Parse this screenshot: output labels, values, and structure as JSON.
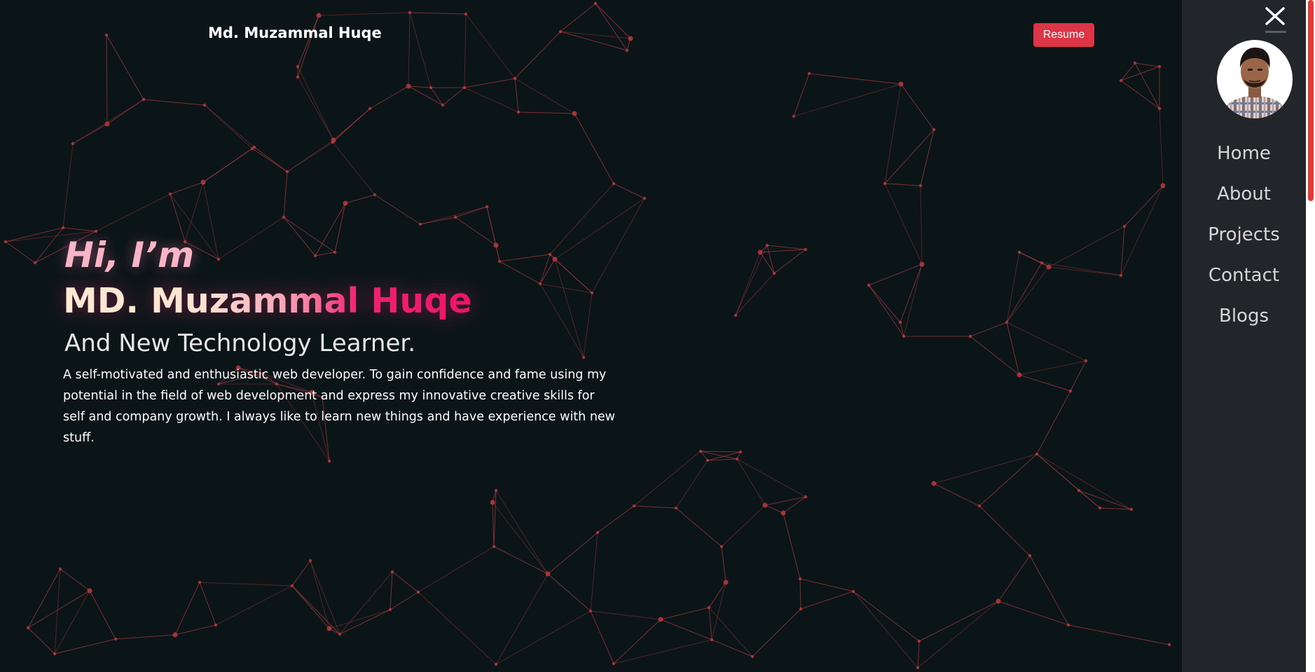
{
  "header": {
    "brand": "Md. Muzammal Huqe",
    "resume_label": "Resume"
  },
  "hero": {
    "greeting": "Hi, I’m",
    "name": "MD. Muzammal Huqe",
    "subtitle": "And New Technology Learner.",
    "bio": "A self-motivated and enthusiastic web developer. To gain confidence and fame using my potential in the field of web development and express my innovative creative skills for self and company growth. I always like to learn new things and have experience with new stuff."
  },
  "sidebar": {
    "close_icon": "close-icon",
    "avatar_alt": "profile-photo",
    "nav": [
      {
        "label": "Home"
      },
      {
        "label": "About"
      },
      {
        "label": "Projects"
      },
      {
        "label": "Contact"
      },
      {
        "label": "Blogs"
      }
    ]
  },
  "colors": {
    "background": "#0b1518",
    "sidebar": "#222529",
    "accent": "#dc3545",
    "name_pink": "#ea1568",
    "network": "#c0393f"
  }
}
